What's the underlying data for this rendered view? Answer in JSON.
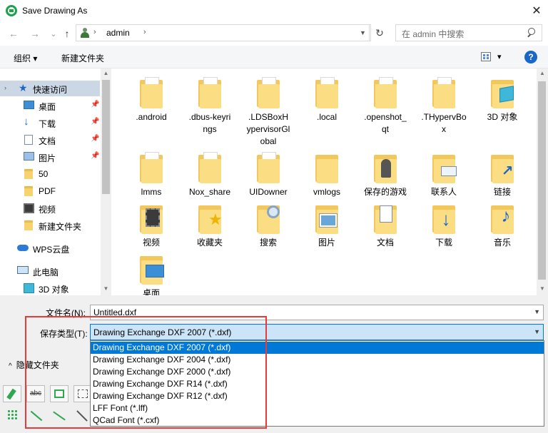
{
  "window": {
    "title": "Save Drawing As",
    "close_glyph": "✕"
  },
  "nav": {
    "back": "←",
    "forward": "→",
    "recent": "⌄",
    "up": "↑",
    "separator": "›",
    "location": "admin",
    "refresh": "↻",
    "search_placeholder": "在 admin 中搜索"
  },
  "toolbar": {
    "organize": "组织 ▾",
    "new_folder": "新建文件夹",
    "view_dropdown": "▾",
    "help": "?"
  },
  "sidebar": {
    "items": [
      {
        "label": "快速访问",
        "icon": "star-icon",
        "pinned": false
      },
      {
        "label": "桌面",
        "icon": "desktop-icon",
        "pinned": true
      },
      {
        "label": "下载",
        "icon": "download-icon",
        "pinned": true
      },
      {
        "label": "文档",
        "icon": "document-icon",
        "pinned": true
      },
      {
        "label": "图片",
        "icon": "picture-icon",
        "pinned": true
      },
      {
        "label": "50",
        "icon": "folder-icon",
        "pinned": false
      },
      {
        "label": "PDF",
        "icon": "folder-icon",
        "pinned": false
      },
      {
        "label": "视频",
        "icon": "video-icon",
        "pinned": false
      },
      {
        "label": "新建文件夹",
        "icon": "folder-icon",
        "pinned": false
      },
      {
        "label": "WPS云盘",
        "icon": "cloud-icon",
        "pinned": false
      },
      {
        "label": "此电脑",
        "icon": "computer-icon",
        "pinned": false
      },
      {
        "label": "3D 对象",
        "icon": "3d-objects-icon",
        "pinned": false
      }
    ]
  },
  "files": [
    {
      "name": ".android",
      "icon": "folder-icon"
    },
    {
      "name": ".dbus-keyrings",
      "icon": "folder-icon"
    },
    {
      "name": ".LDSBoxHypervisorGlobal",
      "icon": "folder-icon"
    },
    {
      "name": ".local",
      "icon": "folder-icon"
    },
    {
      "name": ".openshot_qt",
      "icon": "folder-icon"
    },
    {
      "name": ".THypervBox",
      "icon": "folder-icon"
    },
    {
      "name": "3D 对象",
      "icon": "3d-objects-icon"
    },
    {
      "name": "lmms",
      "icon": "folder-icon"
    },
    {
      "name": "Nox_share",
      "icon": "folder-icon"
    },
    {
      "name": "UIDowner",
      "icon": "folder-icon"
    },
    {
      "name": "vmlogs",
      "icon": "folder-icon"
    },
    {
      "name": "保存的游戏",
      "icon": "saved-games-icon"
    },
    {
      "name": "联系人",
      "icon": "contacts-icon"
    },
    {
      "name": "链接",
      "icon": "links-icon"
    },
    {
      "name": "视频",
      "icon": "video-folder-icon"
    },
    {
      "name": "收藏夹",
      "icon": "favorites-icon"
    },
    {
      "name": "搜索",
      "icon": "search-folder-icon"
    },
    {
      "name": "图片",
      "icon": "pictures-folder-icon"
    },
    {
      "name": "文档",
      "icon": "documents-folder-icon"
    },
    {
      "name": "下载",
      "icon": "downloads-folder-icon"
    },
    {
      "name": "音乐",
      "icon": "music-folder-icon"
    },
    {
      "name": "桌面",
      "icon": "desktop-folder-icon"
    }
  ],
  "form": {
    "filename_label": "文件名(N):",
    "filename_value": "Untitled.dxf",
    "filetype_label": "保存类型(T):",
    "filetype_value": "Drawing Exchange DXF 2007 (*.dxf)",
    "hide_folders": "隐藏文件夹",
    "options": [
      "Drawing Exchange DXF 2007 (*.dxf)",
      "Drawing Exchange DXF 2004 (*.dxf)",
      "Drawing Exchange DXF 2000 (*.dxf)",
      "Drawing Exchange DXF R14 (*.dxf)",
      "Drawing Exchange DXF R12 (*.dxf)",
      "LFF Font (*.lff)",
      "QCad Font (*.cxf)"
    ],
    "selected_option_index": 0
  },
  "qcad_toolbar": {
    "tools": [
      "pencil-icon",
      "text-icon",
      "rectangle-select-icon",
      "deselect-icon",
      "grid-icon",
      "polyline-icon",
      "spline-icon",
      "curve-icon"
    ]
  },
  "colors": {
    "accent": "#0078d7",
    "highlight_box": "#e53b3b",
    "selection": "#ccd7e6",
    "folder": "#f6d36e"
  }
}
